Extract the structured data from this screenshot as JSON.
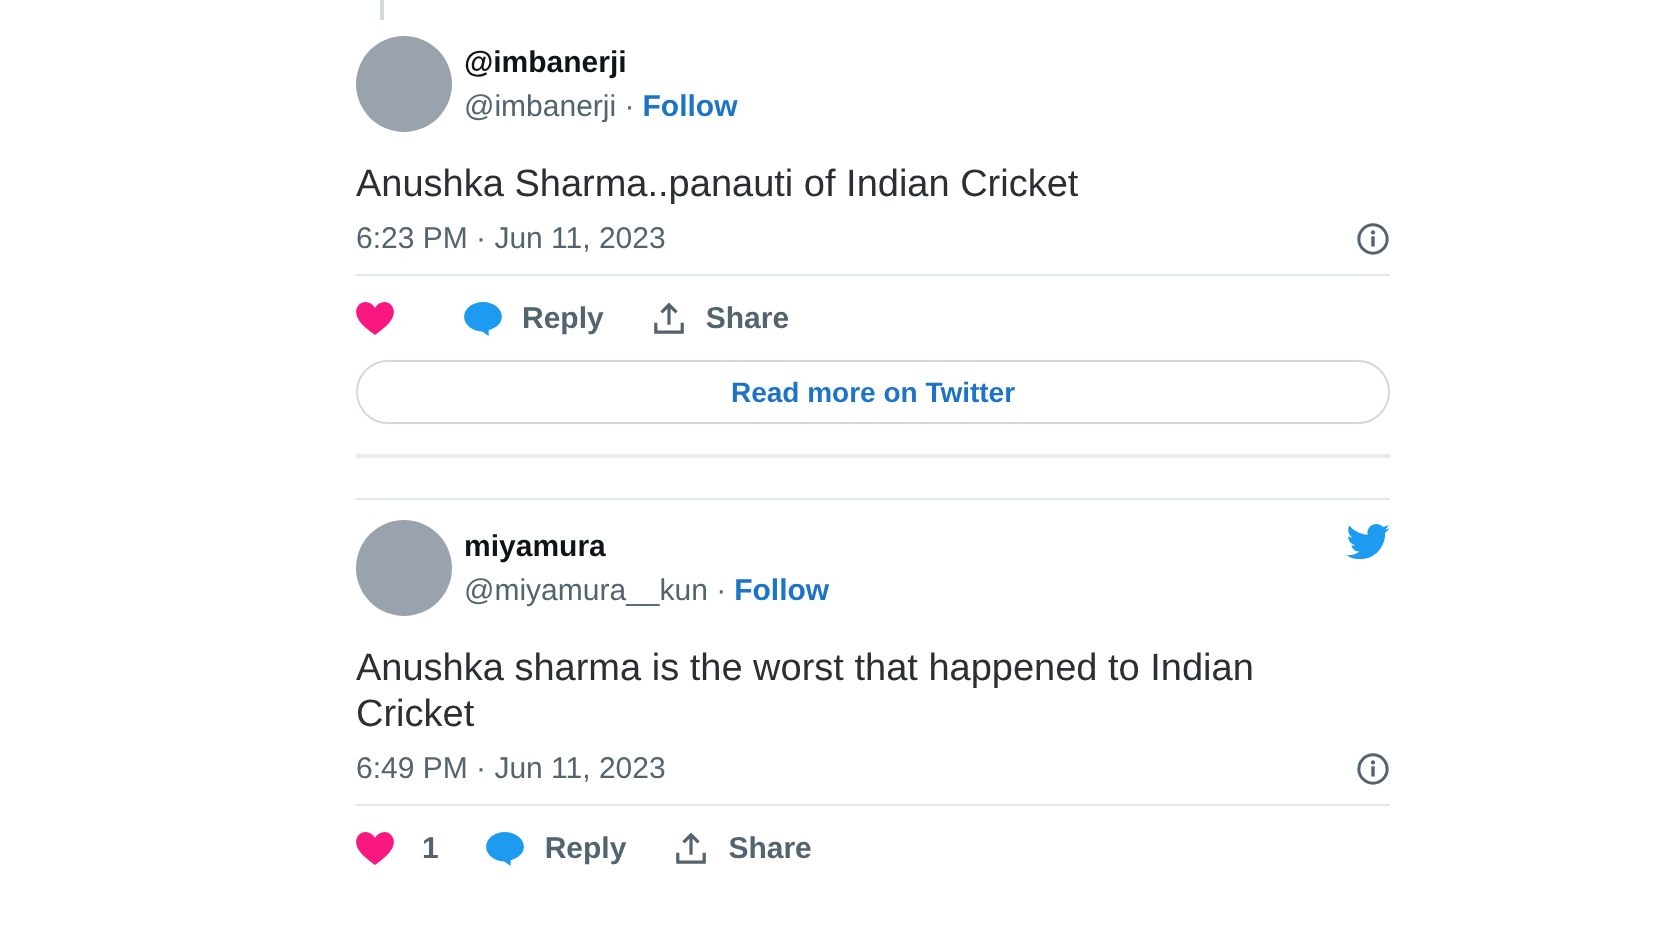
{
  "tweets": [
    {
      "name": "@imbanerji",
      "handle": "@imbanerji ·",
      "follow": "Follow",
      "text": "Anushka Sharma..panauti of Indian Cricket",
      "time": "6:23 PM · Jun 11, 2023",
      "logo": false,
      "reply": "Reply",
      "share": "Share",
      "read_more": "Read more on Twitter"
    },
    {
      "name": "miyamura",
      "handle": "@miyamura__kun ·",
      "follow": "Follow",
      "text": "Anushka sharma is the worst that happened to Indian Cricket",
      "time": "6:49 PM · Jun 11, 2023",
      "logo": true,
      "likes": "1",
      "reply": "Reply",
      "share": "Share"
    }
  ]
}
